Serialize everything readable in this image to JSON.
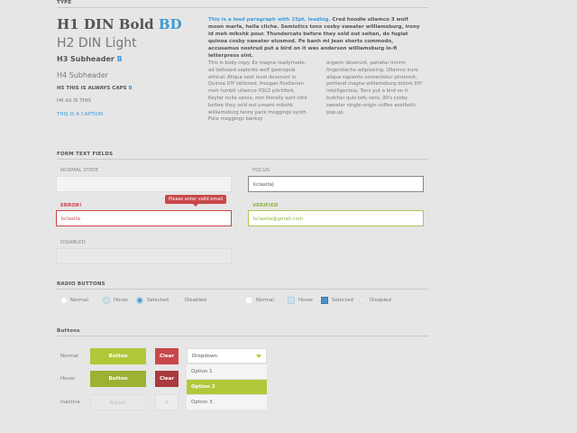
{
  "type": {
    "section_title": "TYPE",
    "h1": "H1 DIN Bold",
    "h1_accent": "BD",
    "h2": "H2 DIN Light",
    "h3": "H3 Subheader",
    "h3_accent": "B",
    "h4": "H4 Subheader",
    "h5": "H5 THIS IS ALWAYS CAPS",
    "h5_accent": "B",
    "h6": "H6 AS IS THIS",
    "caption": "THIS IS A CAPTION",
    "lead_accent": "This is a lead paragraph with 15pt. leading.",
    "lead_rest": " Cred hoodie ullamco 3 wolf moon marfa, hella cliche. Semiotics tonx cosby sweater williamsburg, irony id meh mikshk pour. Thundercats before they sold out seitan, do fugiat quinoa cosby sweater eiusmod. Pe banh mi jean shorts commodo, accusamus nostrud put a bird on it wes anderson williamsburg lo-fi letterpress sint.",
    "body_col1": "This is body copy. Ex magna readymade, ad tattooed sapiente wolf gastropub ethical. Aliqua next level deserunt in. Quinoa DIY tattooed, freegan flexitarian meh tumblr ullamco YOLO pitchfork. Keytar nulla salvia, non literally sunt nihil before they sold out umami mikshk williamsburg fanny pack meggings synth. Fixie meggings banksy",
    "body_col2": "organic deserunt, pariatur minim fingerstache adipisicing. Ullamco irure aliqua sapiente consectetur pinterest, portland magna williamsburg dolore DIY intelligentsia. Tonx put a bird on it butcher quis tofu vero, 90's cosby sweater single-origin coffee aesthetic pop-up."
  },
  "form": {
    "section_title": "FORM TEXT FIELDS",
    "normal_label": "NORMAL STATE",
    "normal_value": "",
    "focus_label": "FOCUS",
    "focus_value": "kclasita|",
    "error_label": "ERROR!",
    "error_value": "kclasita",
    "error_tooltip": "Please enter valid email",
    "verified_label": "VERIFIED",
    "verified_value": "kclasita@gmail.com",
    "disabled_label": "DISABLED",
    "disabled_value": ""
  },
  "radio": {
    "section_title": "RADIO BUTTONS",
    "labels": [
      "Normal",
      "Hover",
      "Selected",
      "Disabled"
    ],
    "check_labels": [
      "Normal",
      "Hover",
      "Selected",
      "Disabled"
    ]
  },
  "buttons": {
    "section_title": "Buttons",
    "row_labels": [
      "Normal",
      "Hover",
      "Inactive"
    ],
    "primary_label": "Button",
    "inactive_primary_label": "Button",
    "clear_label": "Clear",
    "inactive_clear_label": "X",
    "dropdown": {
      "selected": "Dropdown",
      "options": [
        "Option 1",
        "Option 2",
        "Option 3"
      ],
      "highlighted_index": 1
    }
  },
  "colors": {
    "accent_blue": "#3f9ad6",
    "green": "#afc93a",
    "red": "#c9474b"
  }
}
